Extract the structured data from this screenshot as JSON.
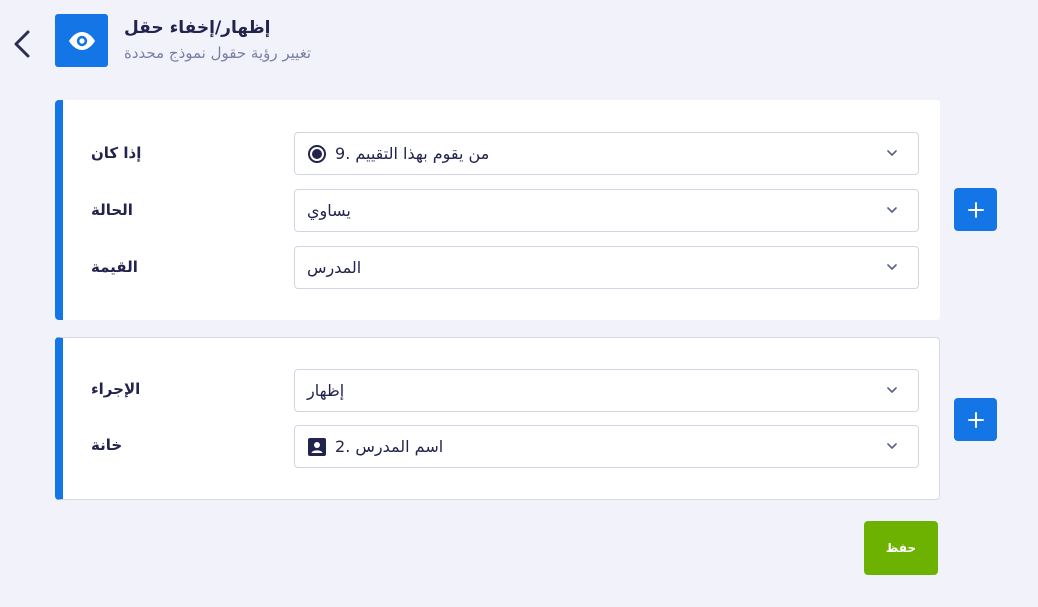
{
  "header": {
    "title": "إظهار/إخفاء حقل",
    "subtitle": "تغيير رؤية حقول نموذج محددة",
    "icon": "eye-icon",
    "accent_color": "#1475e6"
  },
  "condition_card": {
    "rows": [
      {
        "label": "إذا كان",
        "value": "من يقوم بهذا التقييم .9",
        "icon": "radio-icon"
      },
      {
        "label": "الحالة",
        "value": "يساوي"
      },
      {
        "label": "القيمة",
        "value": "المدرس"
      }
    ]
  },
  "action_card": {
    "rows": [
      {
        "label": "الإجراء",
        "value": "إظهار"
      },
      {
        "label": "خانة",
        "value": "اسم المدرس .2",
        "icon": "contact-card-icon"
      }
    ]
  },
  "save_label": "حفظ",
  "save_color": "#6db200"
}
